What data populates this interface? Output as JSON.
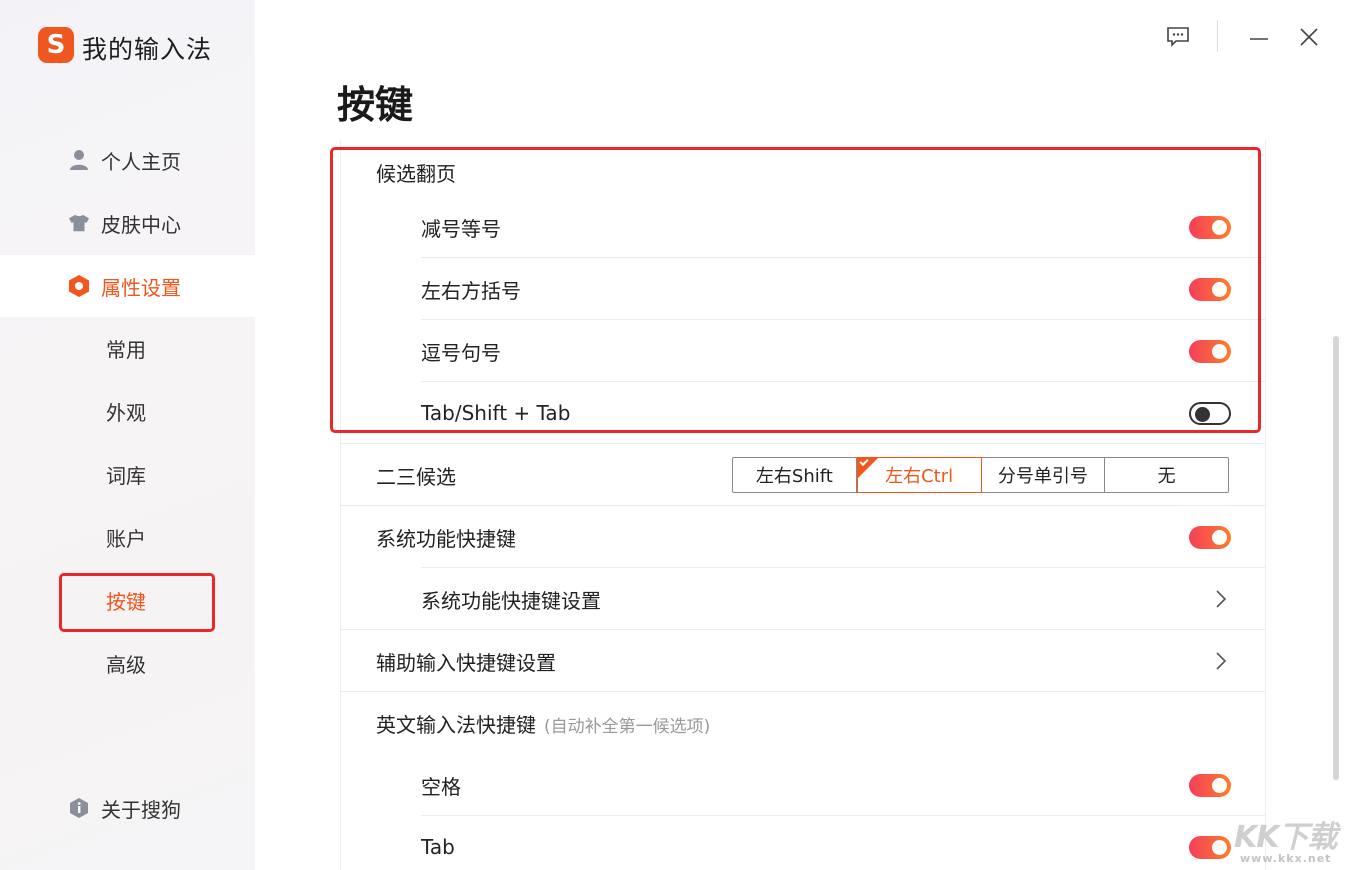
{
  "app": {
    "title": "我的输入法",
    "logo_letter": "S"
  },
  "nav": {
    "personal": "个人主页",
    "skin": "皮肤中心",
    "settings": "属性设置",
    "about": "关于搜狗"
  },
  "sub_nav": [
    "常用",
    "外观",
    "词库",
    "账户",
    "按键",
    "高级"
  ],
  "page": {
    "title": "按键"
  },
  "section_page_turn": {
    "title": "候选翻页",
    "items": [
      {
        "label": "减号等号",
        "on": true
      },
      {
        "label": "左右方括号",
        "on": true
      },
      {
        "label": "逗号句号",
        "on": true
      },
      {
        "label": "Tab/Shift + Tab",
        "on": false
      }
    ]
  },
  "second_third": {
    "label": "二三候选",
    "options": [
      "左右Shift",
      "左右Ctrl",
      "分号单引号",
      "无"
    ],
    "selected": "左右Ctrl"
  },
  "system_shortcut": {
    "label": "系统功能快捷键",
    "on": true
  },
  "system_shortcut_settings": {
    "label": "系统功能快捷键设置"
  },
  "assist_shortcut_settings": {
    "label": "辅助输入快捷键设置"
  },
  "english_shortcut": {
    "label": "英文输入法快捷键",
    "hint": "(自动补全第一候选项)",
    "items": [
      {
        "label": "空格",
        "on": true
      },
      {
        "label": "Tab",
        "on": true
      }
    ]
  },
  "watermark": {
    "main": "KK下载",
    "url": "www.kkx.net"
  },
  "colors": {
    "accent": "#f2561d",
    "highlight": "#e8282a",
    "toggle_start": "#f43e5b",
    "toggle_end": "#ff7d2a"
  },
  "icons": [
    "feedback-icon",
    "minimize-icon",
    "close-icon",
    "user-icon",
    "shirt-icon",
    "hexagon-settings-icon",
    "info-icon",
    "chevron-right-icon"
  ]
}
